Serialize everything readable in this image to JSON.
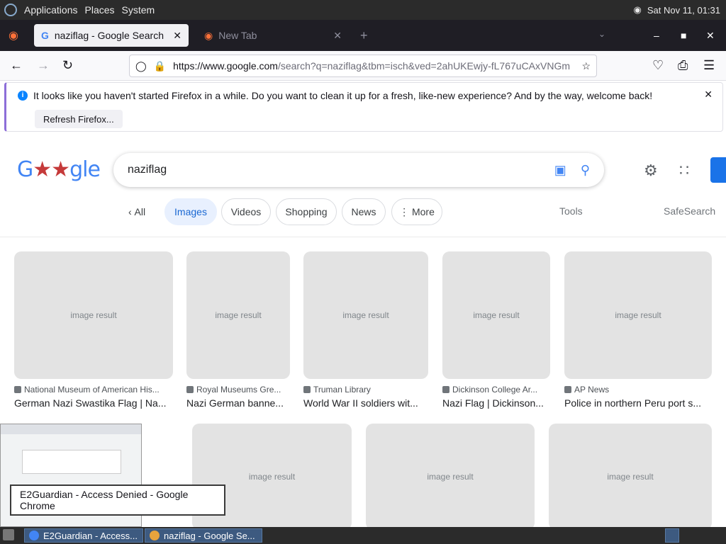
{
  "desktop": {
    "menu": [
      "Applications",
      "Places",
      "System"
    ],
    "clock": "Sat Nov 11, 01:31"
  },
  "browser": {
    "active_tab": "naziflag - Google Search",
    "inactive_tab": "New Tab",
    "url_host": "https://www.google.com",
    "url_path": "/search?q=naziflag&tbm=isch&ved=2ahUKEwjy-fL767uCAxVNGm",
    "notification": "It looks like you haven't started Firefox in a while. Do you want to clean it up for a fresh, like-new experience? And by the way, welcome back!",
    "refresh_label": "Refresh Firefox..."
  },
  "search": {
    "query": "naziflag",
    "chips": [
      "All",
      "Images",
      "Videos",
      "Shopping",
      "News",
      "More"
    ],
    "tools": "Tools",
    "safesearch": "SafeSearch"
  },
  "results_row1": [
    {
      "source": "National Museum of American His...",
      "title": "German Nazi Swastika Flag | Na..."
    },
    {
      "source": "Royal Museums Gre...",
      "title": "Nazi German banne..."
    },
    {
      "source": "Truman Library",
      "title": "World War II soldiers wit..."
    },
    {
      "source": "Dickinson College Ar...",
      "title": "Nazi Flag | Dickinson..."
    },
    {
      "source": "AP News",
      "title": "Police in northern Peru port s..."
    }
  ],
  "results_row2": [
    {
      "note": "image"
    },
    {
      "note": "image"
    },
    {
      "note": "image"
    },
    {
      "note": "image"
    }
  ],
  "tooltip": "E2Guardian - Access Denied - Google Chrome",
  "taskbar": {
    "task1": "E2Guardian - Access...",
    "task2": "naziflag - Google Se..."
  },
  "thumb_placeholder": "image result"
}
